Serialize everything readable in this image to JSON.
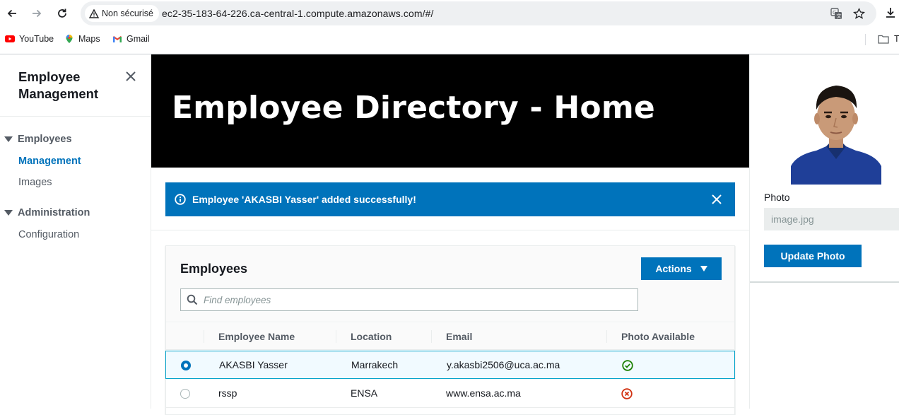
{
  "browser": {
    "security_label": "Non sécurisé",
    "url": "ec2-35-183-64-226.ca-central-1.compute.amazonaws.com/#/",
    "bookmarks": [
      {
        "label": "YouTube",
        "icon": "youtube-icon"
      },
      {
        "label": "Maps",
        "icon": "maps-icon"
      },
      {
        "label": "Gmail",
        "icon": "gmail-icon"
      }
    ],
    "overflow_folder_label": "T"
  },
  "sidebar": {
    "title": "Employee Management",
    "sections": [
      {
        "label": "Employees",
        "items": [
          {
            "label": "Management",
            "active": true
          },
          {
            "label": "Images",
            "active": false
          }
        ]
      },
      {
        "label": "Administration",
        "items": [
          {
            "label": "Configuration",
            "active": false
          }
        ]
      }
    ]
  },
  "header": {
    "title": "Employee Directory - Home"
  },
  "flash": {
    "message": "Employee 'AKASBI Yasser' added successfully!"
  },
  "table": {
    "title": "Employees",
    "actions_label": "Actions",
    "search_placeholder": "Find employees",
    "columns": [
      "Employee Name",
      "Location",
      "Email",
      "Photo Available"
    ],
    "rows": [
      {
        "name": "AKASBI Yasser",
        "location": "Marrakech",
        "email": "y.akasbi2506@uca.ac.ma",
        "photo_available": true,
        "selected": true
      },
      {
        "name": "rssp",
        "location": "ENSA",
        "email": "www.ensa.ac.ma",
        "photo_available": false,
        "selected": false
      }
    ]
  },
  "right_panel": {
    "photo_label": "Photo",
    "photo_value": "image.jpg",
    "update_label": "Update Photo"
  },
  "colors": {
    "accent": "#0073bb",
    "success": "#1d8102",
    "error": "#d13212",
    "header_bg": "#000000"
  }
}
